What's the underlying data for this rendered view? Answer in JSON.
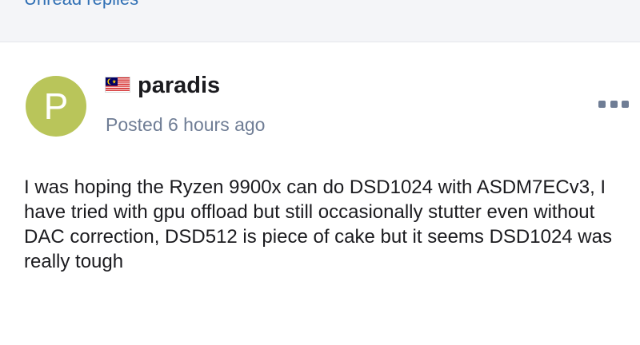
{
  "header": {
    "unread_replies_link": "Unread replies"
  },
  "post": {
    "avatar_letter": "P",
    "avatar_color": "#b9c55a",
    "author_flag": "malaysia-flag-icon",
    "author": "paradis",
    "posted_time": "Posted 6 hours ago",
    "more_icon": "ellipsis-icon",
    "body": "I was hoping the Ryzen 9900x can do DSD1024 with ASDM7ECv3, I have tried with gpu offload but still occasionally stutter even without DAC correction, DSD512 is piece of cake but it seems DSD1024 was really tough"
  },
  "colors": {
    "link": "#2f6fb4",
    "meta": "#6f7d95",
    "text": "#1b1b1f"
  }
}
